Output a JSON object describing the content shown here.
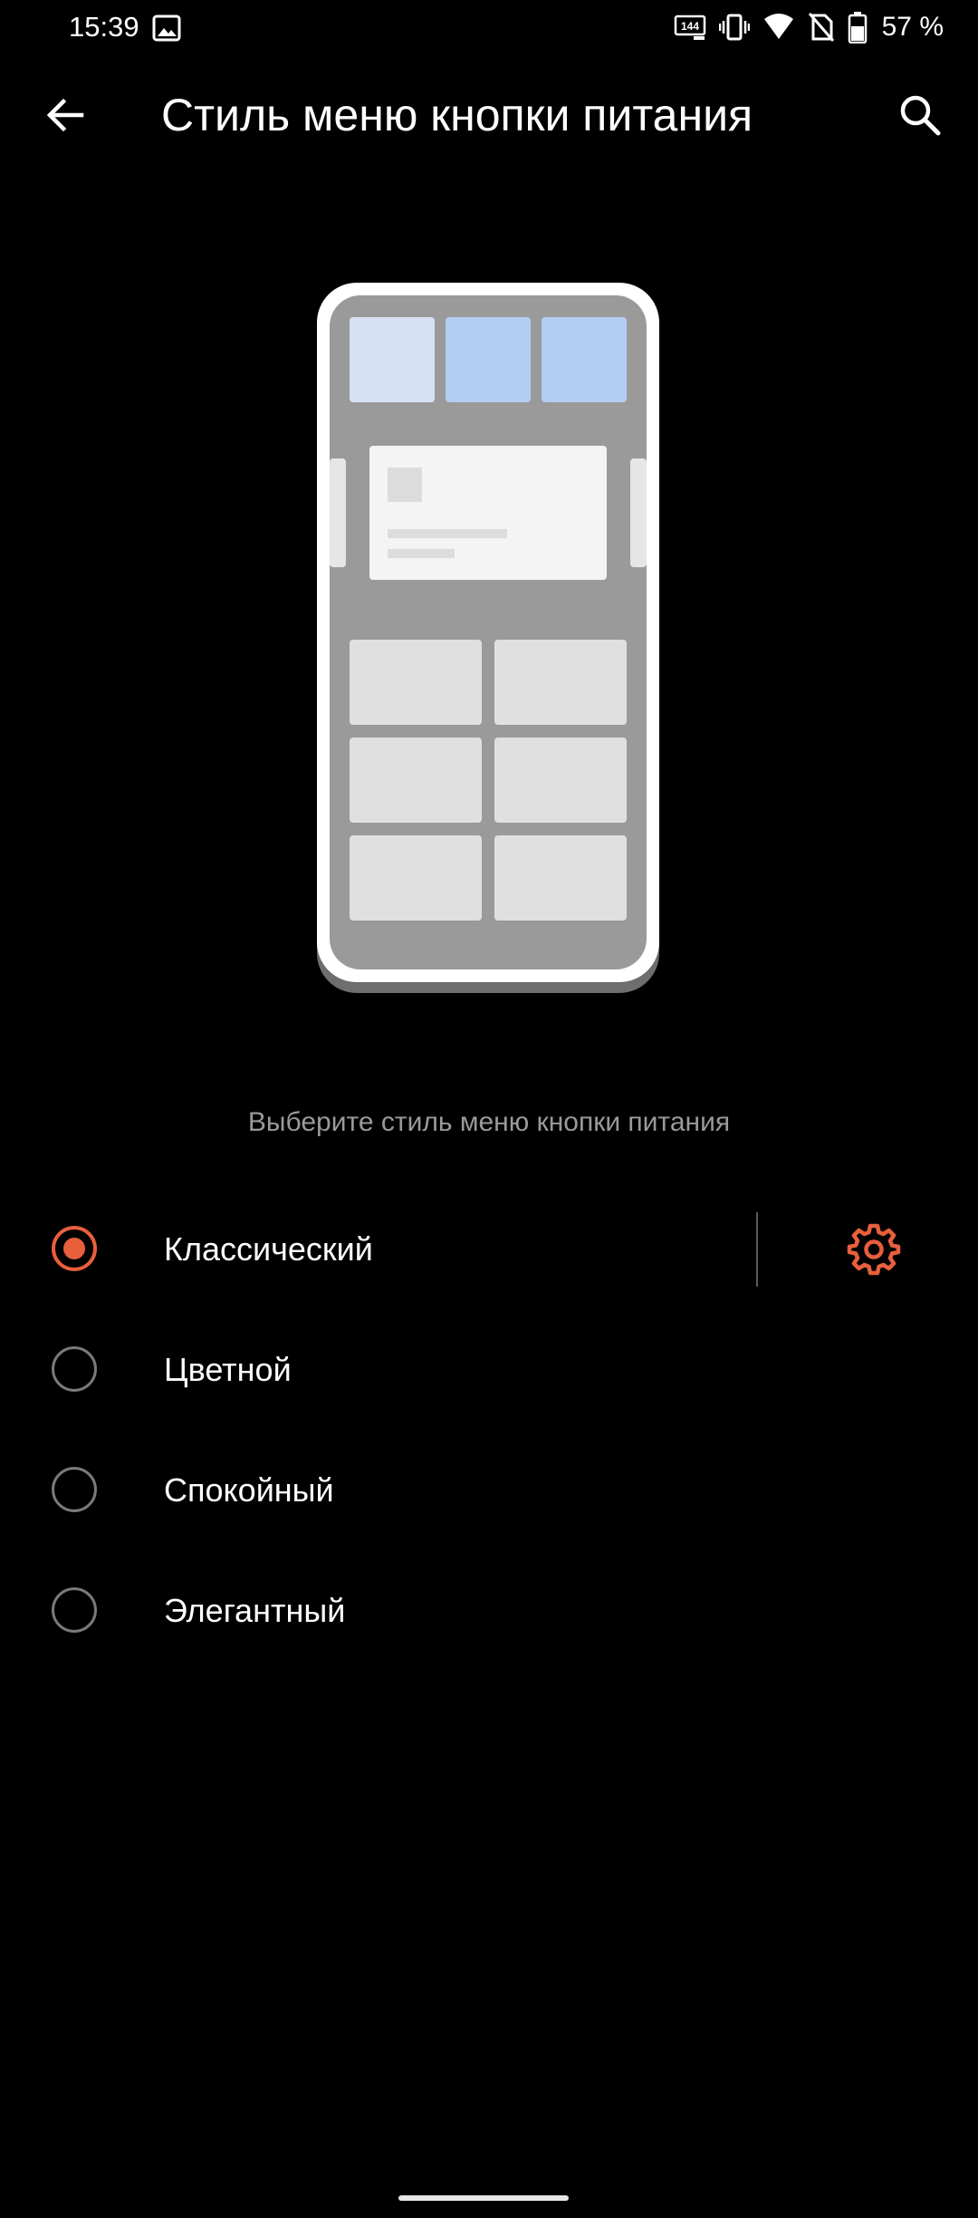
{
  "status_bar": {
    "time": "15:39",
    "battery_text": "57 %",
    "refresh_badge": "144",
    "icons": [
      "gallery-icon",
      "refresh-rate-icon",
      "vibrate-icon",
      "wifi-icon",
      "no-sim-icon",
      "battery-icon"
    ]
  },
  "app_bar": {
    "title": "Стиль меню кнопки питания",
    "back_icon": "arrow-left-icon",
    "search_icon": "search-icon"
  },
  "preview": {
    "illustration": "power-menu-classic-preview",
    "colors": {
      "frame": "#ffffff",
      "screen": "#9a9a9a",
      "tile_light": "#d6e2f4",
      "tile_blue": "#b3cdf2",
      "card": "#f4f4f4",
      "button": "#e0e0e0"
    }
  },
  "subtitle": "Выберите стиль меню кнопки питания",
  "options": [
    {
      "label": "Классический",
      "selected": true,
      "has_settings": true
    },
    {
      "label": "Цветной",
      "selected": false,
      "has_settings": false
    },
    {
      "label": "Спокойный",
      "selected": false,
      "has_settings": false
    },
    {
      "label": "Элегантный",
      "selected": false,
      "has_settings": false
    }
  ],
  "colors": {
    "accent": "#e85f3c",
    "background": "#000000",
    "text_primary": "#ffffff",
    "text_secondary": "#9a9a9a"
  }
}
